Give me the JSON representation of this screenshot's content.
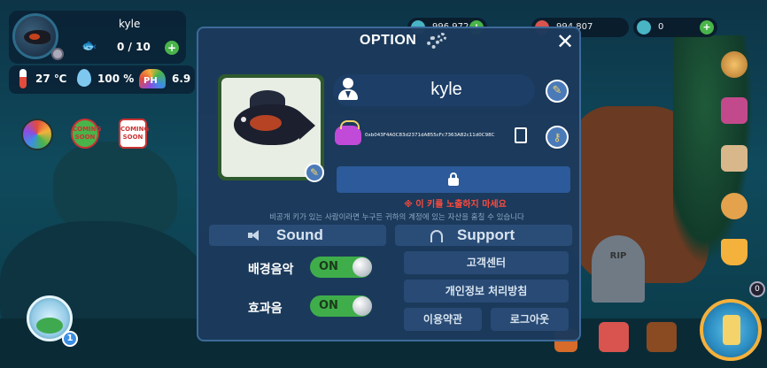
{
  "hud": {
    "username": "kyle",
    "fish_count": "0 / 10",
    "temperature": "27 ℃",
    "water_quality": "100 %",
    "ph_label": "PH",
    "ph_value": "6.9",
    "coming_soon_1": "COMING SOON",
    "coming_soon_2": "COMING SOON",
    "tank_badge": "1",
    "right_badge": "0",
    "currencies": [
      {
        "icon": "gem-icon",
        "value": "996,972"
      },
      {
        "icon": "coin-icon",
        "value": "994,807"
      },
      {
        "icon": "shell-icon",
        "value": "0"
      }
    ],
    "tombstone_text": "RIP"
  },
  "modal": {
    "title": "OPTION",
    "close_label": "✕",
    "player_name": "kyle",
    "wallet_address": "0xb043F4A0C83d2371dA855cFc7363A82c11d0C98C",
    "warning_title": "※ 이 키를 노출하지 마세요",
    "warning_text": "비공개 키가 있는 사람이라면 누구든 귀하의 계정에 있는 자산을 훔칠 수 있습니다",
    "sound": {
      "header": "Sound",
      "bgm_label": "배경음악",
      "bgm_state": "ON",
      "sfx_label": "효과음",
      "sfx_state": "ON"
    },
    "support": {
      "header": "Support",
      "customer_center": "고객센터",
      "privacy_policy": "개인정보 처리방침",
      "terms": "이용약관",
      "logout": "로그아웃"
    }
  },
  "colors": {
    "toggle_on": "#3fae4a",
    "warning": "#ff4a3c",
    "modal_bg": "#1c3a5c"
  }
}
